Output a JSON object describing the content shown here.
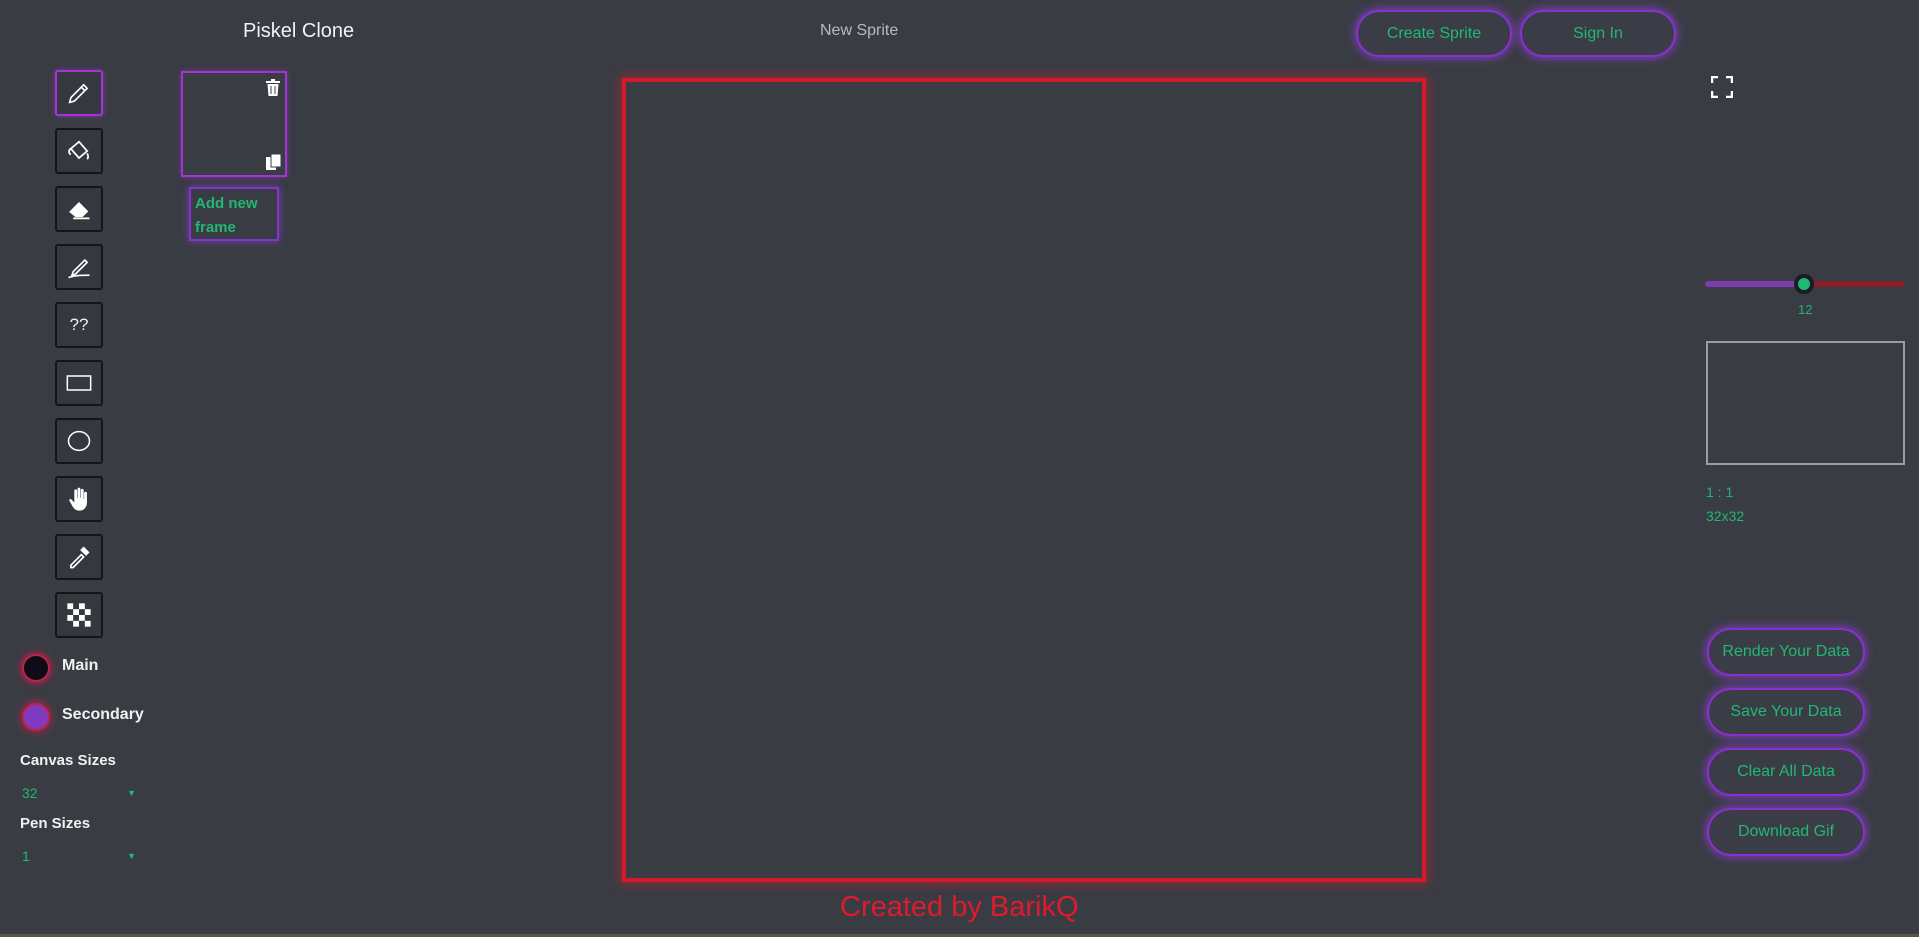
{
  "header": {
    "app_title": "Piskel Clone",
    "sprite_name": "New Sprite",
    "create_sprite": "Create Sprite",
    "sign_in": "Sign In"
  },
  "tools": [
    {
      "name": "pen",
      "icon": "pencil-icon",
      "active": true
    },
    {
      "name": "paint-bucket",
      "icon": "paint-bucket-icon"
    },
    {
      "name": "eraser",
      "icon": "eraser-icon"
    },
    {
      "name": "stroke",
      "icon": "stroke-icon"
    },
    {
      "name": "unknown",
      "label": "??"
    },
    {
      "name": "rectangle",
      "icon": "rectangle-icon"
    },
    {
      "name": "circle",
      "icon": "circle-icon"
    },
    {
      "name": "move",
      "icon": "hand-icon"
    },
    {
      "name": "color-picker",
      "icon": "eyedropper-icon"
    },
    {
      "name": "dithering",
      "icon": "checkerboard-icon"
    }
  ],
  "colors": {
    "main_label": "Main",
    "main_color": "#0d0d1a",
    "secondary_label": "Secondary",
    "secondary_color": "#7e3bbf"
  },
  "canvas_sizes": {
    "label": "Canvas Sizes",
    "value": "32"
  },
  "pen_sizes": {
    "label": "Pen Sizes",
    "value": "1"
  },
  "frames": {
    "add_label": "Add new frame"
  },
  "footer": {
    "credit": "Created by BarikQ"
  },
  "right_panel": {
    "fps_value": 12,
    "fps_fraction": 0.5,
    "zoom_ratio": "1 : 1",
    "size": "32x32"
  },
  "actions": {
    "render": "Render Your Data",
    "save": "Save Your Data",
    "clear": "Clear All Data",
    "download": "Download Gif"
  },
  "accents": {
    "green": "#21b872",
    "purple": "#8a2fd0",
    "red": "#d11a2a"
  }
}
